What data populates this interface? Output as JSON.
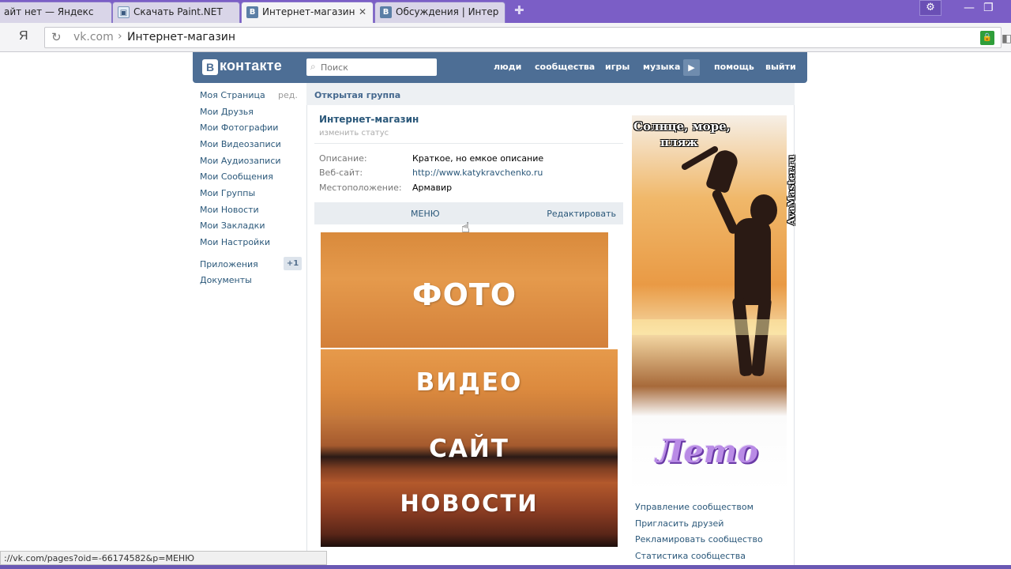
{
  "browser": {
    "tabs": [
      {
        "label": "айт нет — Яндекс",
        "favicon": "yandex-icon"
      },
      {
        "label": "Скачать Paint.NET",
        "favicon": "paint-icon"
      },
      {
        "label": "Интернет-магазин",
        "favicon": "vk-icon"
      },
      {
        "label": "Обсуждения | Интер",
        "favicon": "vk-icon"
      }
    ],
    "yandex_button": "Я",
    "address": {
      "host": "vk.com",
      "separator": "›",
      "title": "Интернет-магазин"
    },
    "status_url": "://vk.com/pages?oid=-66174582&p=МЕНЮ"
  },
  "vk_header": {
    "logo_letter": "В",
    "logo_text": "контакте",
    "search_placeholder": "Поиск",
    "nav": [
      "люди",
      "сообщества",
      "игры",
      "музыка",
      "помощь",
      "выйти"
    ]
  },
  "left_menu": {
    "items": [
      "Моя Страница",
      "Мои Друзья",
      "Мои Фотографии",
      "Мои Видеозаписи",
      "Мои Аудиозаписи",
      "Мои Сообщения",
      "Мои Группы",
      "Мои Новости",
      "Мои Закладки",
      "Мои Настройки"
    ],
    "edit_label": "ред.",
    "extra": [
      "Приложения",
      "Документы"
    ],
    "apps_badge": "+1"
  },
  "group": {
    "type_label": "Открытая группа",
    "name": "Интернет-магазин",
    "status_hint": "изменить статус",
    "info": [
      {
        "label": "Описание:",
        "value": "Краткое, но емкое описание"
      },
      {
        "label": "Веб-сайт:",
        "value": "http://www.katykravchenko.ru"
      },
      {
        "label": "Местоположение:",
        "value": "Армавир"
      }
    ],
    "menu_label": "МЕНЮ",
    "edit_label": "Редактировать",
    "banners": [
      "ФОТО",
      "ВИДЕО",
      "САЙТ",
      "НОВОСТИ"
    ]
  },
  "avatar": {
    "caption_line1": "Солнце, море,",
    "caption_line2": "пляж",
    "watermark": "AvaMaster.ru",
    "title": "Лето"
  },
  "right_links": [
    "Управление сообществом",
    "Пригласить друзей",
    "Рекламировать сообщество",
    "Статистика сообщества"
  ]
}
